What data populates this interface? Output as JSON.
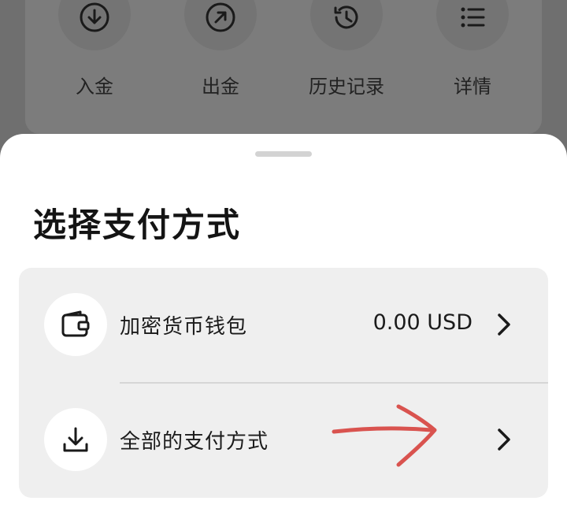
{
  "quick_actions": [
    {
      "label": "入金",
      "icon": "deposit-arrow-down-circle-icon"
    },
    {
      "label": "出金",
      "icon": "withdraw-arrow-up-right-circle-icon"
    },
    {
      "label": "历史记录",
      "icon": "history-clock-icon"
    },
    {
      "label": "详情",
      "icon": "list-icon"
    }
  ],
  "sheet": {
    "title": "选择支付方式",
    "options": [
      {
        "label": "加密货币钱包",
        "value": "0.00 USD",
        "icon": "wallet-icon"
      },
      {
        "label": "全部的支付方式",
        "value": "",
        "icon": "download-icon"
      }
    ]
  },
  "colors": {
    "overlay": "#6f6f6f",
    "sheet_bg": "#ffffff",
    "options_bg": "#efefef",
    "annotation": "#d9534f"
  }
}
